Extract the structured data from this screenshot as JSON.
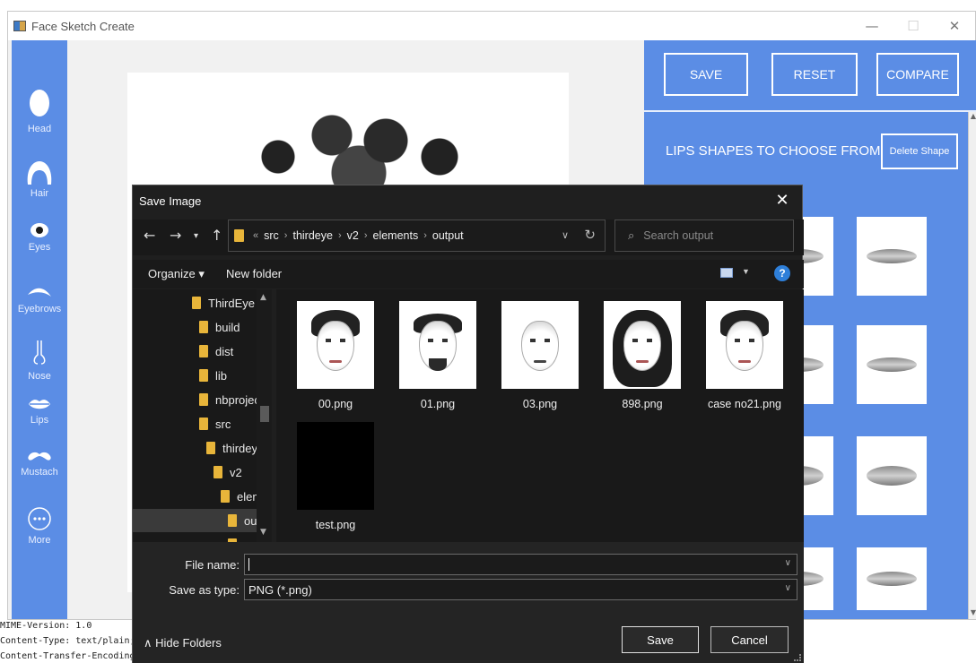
{
  "app": {
    "title": "Face Sketch Create",
    "window_controls": {
      "minimize": "—",
      "maximize": "☐",
      "close": "✕"
    }
  },
  "sidebar": {
    "items": [
      {
        "label": "Head",
        "icon": "head-icon"
      },
      {
        "label": "Hair",
        "icon": "hair-icon"
      },
      {
        "label": "Eyes",
        "icon": "eye-icon"
      },
      {
        "label": "Eyebrows",
        "icon": "eyebrow-icon"
      },
      {
        "label": "Nose",
        "icon": "nose-icon"
      },
      {
        "label": "Lips",
        "icon": "lips-icon"
      },
      {
        "label": "Mustach",
        "icon": "mustache-icon"
      },
      {
        "label": "More",
        "icon": "more-icon"
      }
    ]
  },
  "right_panel": {
    "buttons": {
      "save": "SAVE",
      "reset": "RESET",
      "compare": "COMPARE"
    },
    "heading": "LIPS SHAPES TO CHOOSE FROM",
    "delete_shape": "Delete Shape"
  },
  "dialog": {
    "title": "Save Image",
    "breadcrumb": [
      "src",
      "thirdeye",
      "v2",
      "elements",
      "output"
    ],
    "breadcrumb_prefix": "«",
    "search_placeholder": "Search output",
    "toolbar": {
      "organize": "Organize ▾",
      "new_folder": "New folder",
      "help": "?"
    },
    "tree": [
      {
        "label": "ThirdEye v",
        "indent": 0
      },
      {
        "label": "build",
        "indent": 1
      },
      {
        "label": "dist",
        "indent": 1
      },
      {
        "label": "lib",
        "indent": 1
      },
      {
        "label": "nbprojec",
        "indent": 1
      },
      {
        "label": "src",
        "indent": 1
      },
      {
        "label": "thirdeye",
        "indent": 2
      },
      {
        "label": "v2",
        "indent": 3
      },
      {
        "label": "elem",
        "indent": 4
      },
      {
        "label": "out",
        "indent": 5,
        "selected": true
      }
    ],
    "files": [
      {
        "name": "00.png",
        "kind": "curly"
      },
      {
        "name": "01.png",
        "kind": "beard"
      },
      {
        "name": "03.png",
        "kind": "bald"
      },
      {
        "name": "898.png",
        "kind": "long"
      },
      {
        "name": "case no21.png",
        "kind": "curly"
      },
      {
        "name": "test.png",
        "kind": "black"
      }
    ],
    "file_name_label": "File name:",
    "file_name_value": "",
    "save_type_label": "Save as type:",
    "save_type_value": "PNG (*.png)",
    "hide_folders": "Hide Folders",
    "save_button": "Save",
    "cancel_button": "Cancel"
  },
  "terminal": {
    "lines": [
      "MIME-Version: 1.0",
      "Content-Type: text/plain;",
      "Content-Transfer-Encoding:"
    ]
  },
  "colors": {
    "accent": "#5b8de5",
    "dialog_bg": "#1f1f1f",
    "folder": "#e8b53a"
  }
}
